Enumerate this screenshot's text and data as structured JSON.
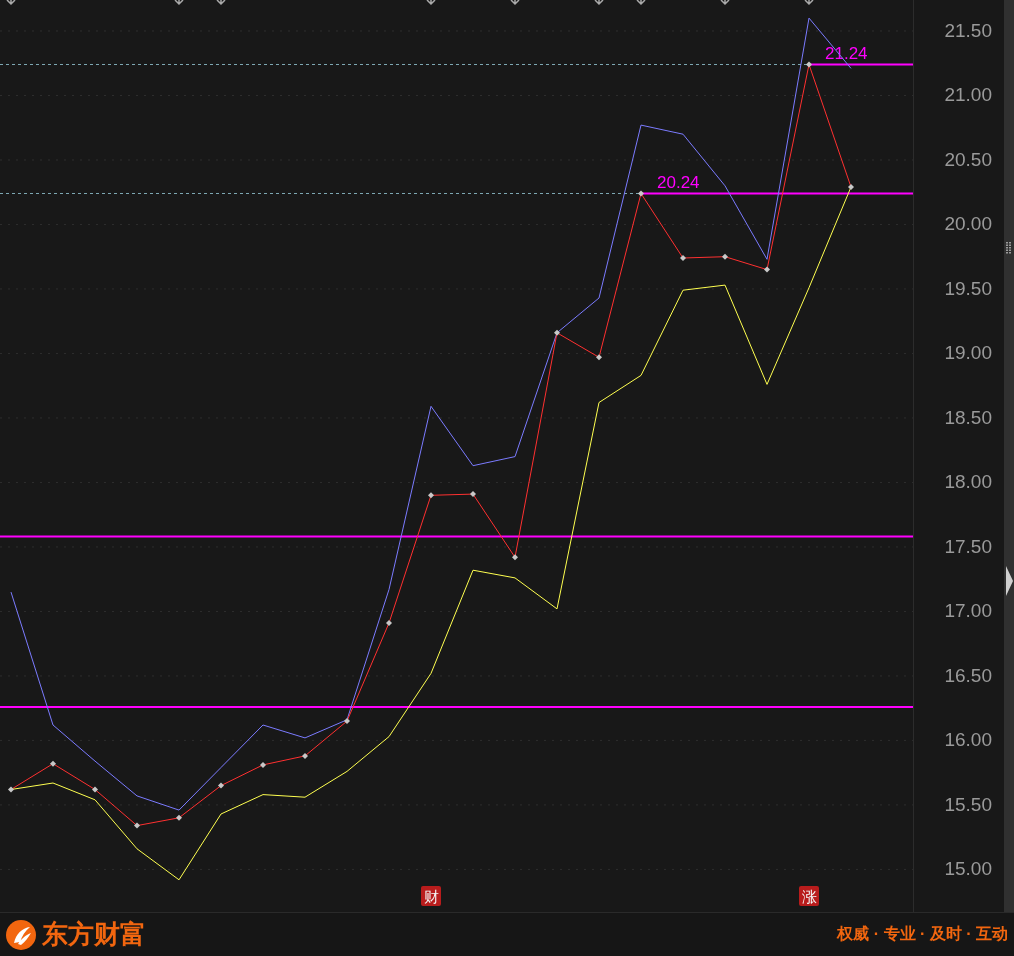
{
  "chart": {
    "chart_data": {
      "type": "line",
      "categories": [
        null,
        null,
        null,
        null,
        null,
        null,
        null,
        null,
        null,
        null,
        null,
        null,
        null,
        null,
        null,
        null,
        null,
        null,
        null,
        null,
        null
      ],
      "series": [
        {
          "color": "#7b7bff",
          "values": [
            17.15,
            16.12,
            15.84,
            15.57,
            15.46,
            15.79,
            16.12,
            16.02,
            16.16,
            17.17,
            18.59,
            18.13,
            18.2,
            19.16,
            19.43,
            20.77,
            20.7,
            20.3,
            19.73,
            21.6,
            21.21
          ]
        },
        {
          "color": "#ff3030",
          "marker": "diamond",
          "values": [
            15.62,
            15.82,
            15.62,
            15.34,
            15.4,
            15.65,
            15.81,
            15.88,
            16.15,
            16.91,
            17.9,
            17.91,
            17.42,
            19.16,
            18.97,
            20.24,
            19.74,
            19.75,
            19.65,
            21.24,
            20.29
          ]
        },
        {
          "color": "#ffff50",
          "values": [
            15.62,
            15.67,
            15.54,
            15.16,
            14.92,
            15.43,
            15.58,
            15.56,
            15.76,
            16.03,
            16.52,
            17.32,
            17.26,
            17.02,
            18.62,
            18.83,
            19.49,
            19.53,
            18.76,
            19.51,
            20.29
          ]
        }
      ],
      "ylim": [
        14.67,
        21.74
      ],
      "grid": true,
      "yticks": [
        {
          "value": 15,
          "label": "15.00"
        },
        {
          "value": 15.5,
          "label": "15.50"
        },
        {
          "value": 16,
          "label": "16.00"
        },
        {
          "value": 16.5,
          "label": "16.50"
        },
        {
          "value": 17,
          "label": "17.00"
        },
        {
          "value": 17.5,
          "label": "17.50"
        },
        {
          "value": 18,
          "label": "18.00"
        },
        {
          "value": 18.5,
          "label": "18.50"
        },
        {
          "value": 19,
          "label": "19.00"
        },
        {
          "value": 19.5,
          "label": "19.50"
        },
        {
          "value": 20,
          "label": "20.00"
        },
        {
          "value": 20.5,
          "label": "20.50"
        },
        {
          "value": 21,
          "label": "21.00"
        },
        {
          "value": 21.5,
          "label": "21.50"
        }
      ],
      "ref_lines": [
        {
          "axis": "y",
          "value": 17.58
        },
        {
          "axis": "y",
          "value": 16.26
        },
        {
          "axis": "y",
          "value": 20.24,
          "label": "20.24"
        },
        {
          "axis": "y",
          "value": 21.24,
          "label": "21.24"
        }
      ]
    },
    "event_badges": [
      "财",
      "涨"
    ]
  },
  "footer": {
    "brand": "东方财富",
    "slogan": "权威 · 专业 · 及时 · 互动"
  }
}
